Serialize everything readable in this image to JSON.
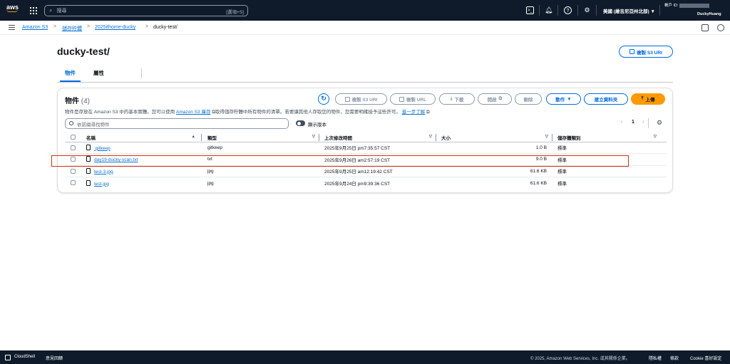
{
  "topbar": {
    "logo_text": "aws",
    "search_placeholder": "搜尋",
    "search_shortcut": "[選項+S]",
    "region": "美國 (維吉尼亞州北部) ▼",
    "account_label": "帳戶 ID:",
    "user": "DuckyHuang"
  },
  "breadcrumb": {
    "items": [
      "Amazon S3",
      "儲存貯體",
      "2025ithome-ducky"
    ],
    "current": "ducky-test/"
  },
  "page": {
    "title": "ducky-test/",
    "copy_uri": "複製 S3 URI",
    "tabs": [
      "物件",
      "屬性"
    ]
  },
  "panel": {
    "title": "物件",
    "count": "(4)",
    "desc_1": "物件是存放在 Amazon S3 中的基本實體。您可以使用",
    "desc_link1": "Amazon S3 庫存",
    "desc_2": "取得儲存貯體中所有物件的清單。若要讓其他人存取您的物件，您需要明確授予這些許可。",
    "desc_link2": "進一步了解",
    "buttons": {
      "copy_s3_uri": "複製 S3 URI",
      "copy_url": "複製 URL",
      "download": "下載",
      "open": "開啟",
      "delete": "刪除",
      "actions": "動作",
      "create_folder": "建立資料夾",
      "upload": "上傳"
    },
    "filter_placeholder": "依前綴尋找物件",
    "show_versions": "顯示版本",
    "page_number": "1"
  },
  "table": {
    "headers": [
      "名稱",
      "類型",
      "上次修改時間",
      "大小",
      "儲存體類別"
    ],
    "rows": [
      {
        "name": ".gitkeep",
        "type": "gitkeep",
        "modified": "2025年9月25日 pm7:35:57 CST",
        "size": "1.0 B",
        "class": "標準"
      },
      {
        "name": "day19-ducky-scan.txt",
        "type": "txt",
        "modified": "2025年9月26日 am2:57:19 CST",
        "size": "9.0 B",
        "class": "標準"
      },
      {
        "name": "test-3.jpg",
        "type": "jpg",
        "modified": "2025年9月25日 am12:19:42 CST",
        "size": "61.6 KB",
        "class": "標準"
      },
      {
        "name": "test.jpg",
        "type": "jpg",
        "modified": "2025年9月24日 pm9:39:36 CST",
        "size": "61.6 KB",
        "class": "標準"
      }
    ]
  },
  "footer": {
    "cloudshell": "CloudShell",
    "feedback": "意見回饋",
    "copyright": "© 2025, Amazon Web Services, Inc. 或其關係企業。",
    "privacy": "隱私權",
    "terms": "條款",
    "cookies": "Cookie 喜好設定"
  },
  "colors": {
    "accent": "#006ce0",
    "upload": "#ff9900",
    "topbar": "#0f1b2a",
    "highlight": "#d13212"
  }
}
